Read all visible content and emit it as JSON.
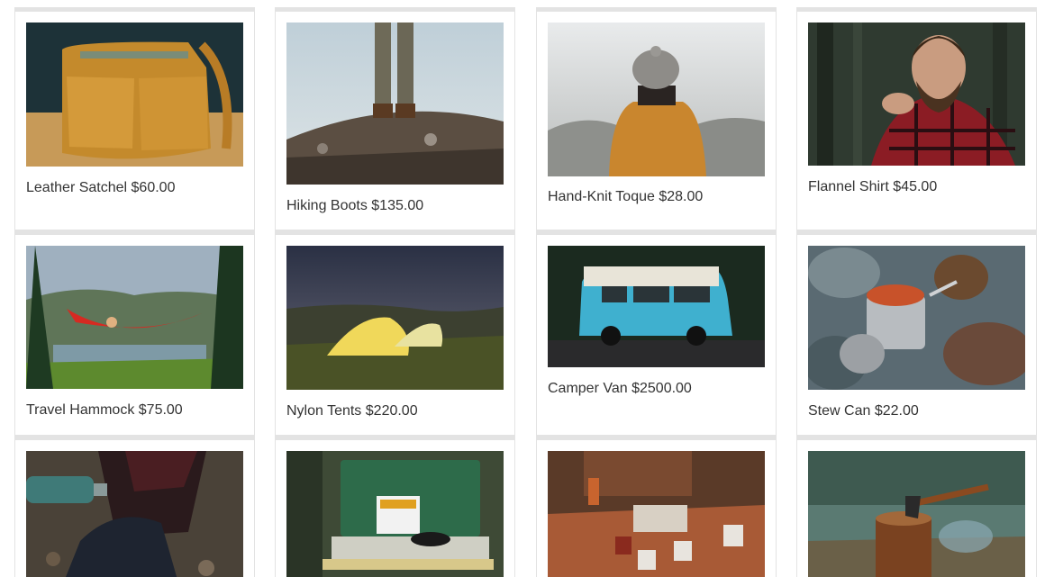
{
  "products": [
    {
      "name": "Leather Satchel",
      "price": "$60.00",
      "image": "leather-satchel-photo"
    },
    {
      "name": "Hiking Boots",
      "price": "$135.00",
      "image": "hiking-boots-photo"
    },
    {
      "name": "Hand-Knit Toque",
      "price": "$28.00",
      "image": "hand-knit-toque-photo"
    },
    {
      "name": "Flannel Shirt",
      "price": "$45.00",
      "image": "flannel-shirt-photo"
    },
    {
      "name": "Travel Hammock",
      "price": "$75.00",
      "image": "travel-hammock-photo"
    },
    {
      "name": "Nylon Tents",
      "price": "$220.00",
      "image": "nylon-tents-photo"
    },
    {
      "name": "Camper Van",
      "price": "$2500.00",
      "image": "camper-van-photo"
    },
    {
      "name": "Stew Can",
      "price": "$22.00",
      "image": "stew-can-photo"
    },
    {
      "name": "",
      "price": "",
      "image": "thermos-photo"
    },
    {
      "name": "",
      "price": "",
      "image": "camp-stove-photo"
    },
    {
      "name": "",
      "price": "",
      "image": "enamel-mugs-photo"
    },
    {
      "name": "",
      "price": "",
      "image": "axe-stump-photo"
    }
  ]
}
